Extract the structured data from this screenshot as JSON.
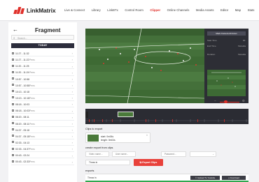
{
  "app": {
    "name": "LinkMatrix"
  },
  "nav": {
    "items": [
      {
        "label": "Live & Connect",
        "active": false
      },
      {
        "label": "Library",
        "active": false
      },
      {
        "label": "LinkBTx",
        "active": false
      },
      {
        "label": "Control Room",
        "active": false
      },
      {
        "label": "Clipper",
        "active": true
      },
      {
        "label": "Online Channels",
        "active": false
      },
      {
        "label": "Media Assets",
        "active": false
      },
      {
        "label": "Editor",
        "active": false
      },
      {
        "label": "Map",
        "active": false
      },
      {
        "label": "Stats",
        "active": false
      },
      {
        "label": "Settings",
        "active": false
      }
    ]
  },
  "fragment_panel": {
    "title": "Fragment",
    "search_placeholder": "Search...",
    "today_label": "TODAY",
    "items": [
      {
        "time": "11:27 - 11:32",
        "kind": ""
      },
      {
        "time": "11:27 - 11:22",
        "kind": "Pens"
      },
      {
        "time": "11:20 - 11:25",
        "kind": ""
      },
      {
        "time": "11:20 - 11:24",
        "kind": "Pens"
      },
      {
        "time": "10:57 - 10:58",
        "kind": ""
      },
      {
        "time": "10:57 - 10:58",
        "kind": "Pens"
      },
      {
        "time": "10:13 - 10:18",
        "kind": ""
      },
      {
        "time": "10:13 - 10:18",
        "kind": "Pens"
      },
      {
        "time": "08:18 - 10:03",
        "kind": ""
      },
      {
        "time": "08:18 - 10:03",
        "kind": "Pens"
      },
      {
        "time": "08:20 - 08:11",
        "kind": ""
      },
      {
        "time": "08:20 - 08:11",
        "kind": "Pens"
      },
      {
        "time": "04:37 - 05:18",
        "kind": ""
      },
      {
        "time": "04:37 - 05:18",
        "kind": "Pens"
      },
      {
        "time": "02:33 - 04:13",
        "kind": ""
      },
      {
        "time": "02:33 - 04:37",
        "kind": "Pens"
      },
      {
        "time": "00:43 - 02:24",
        "kind": ""
      },
      {
        "time": "00:43 - 02:33",
        "kind": "Pens"
      }
    ]
  },
  "side_panel": {
    "header": "Mark Camera All down",
    "rows": [
      {
        "label": "Start Time",
        "value": "00:"
      },
      {
        "label": "End Time",
        "value": "Metadta"
      },
      {
        "label": "Duration",
        "value": "Metadta"
      }
    ]
  },
  "clips": {
    "label": "Clips to export",
    "card": {
      "line1": "start: 0m04s",
      "line2": "length: 0m04s"
    }
  },
  "create_export": {
    "label": "create export from clips",
    "fields": [
      {
        "placeholder": "Video name...",
        "dropdown": false
      },
      {
        "placeholder": "User name...",
        "dropdown": false
      },
      {
        "placeholder": "Password...",
        "dropdown": false
      },
      {
        "placeholder": "",
        "dropdown": true
      }
    ],
    "throw_in": "Throw in",
    "export_button": "Export Clips"
  },
  "exports": {
    "label": "exports",
    "row_label": "Throw in",
    "upload_button": "Upload To Youtube",
    "download_button": "Download"
  },
  "colors": {
    "accent": "#e0312b",
    "dark": "#2c2d3c",
    "pitch": "#3f6a32"
  }
}
